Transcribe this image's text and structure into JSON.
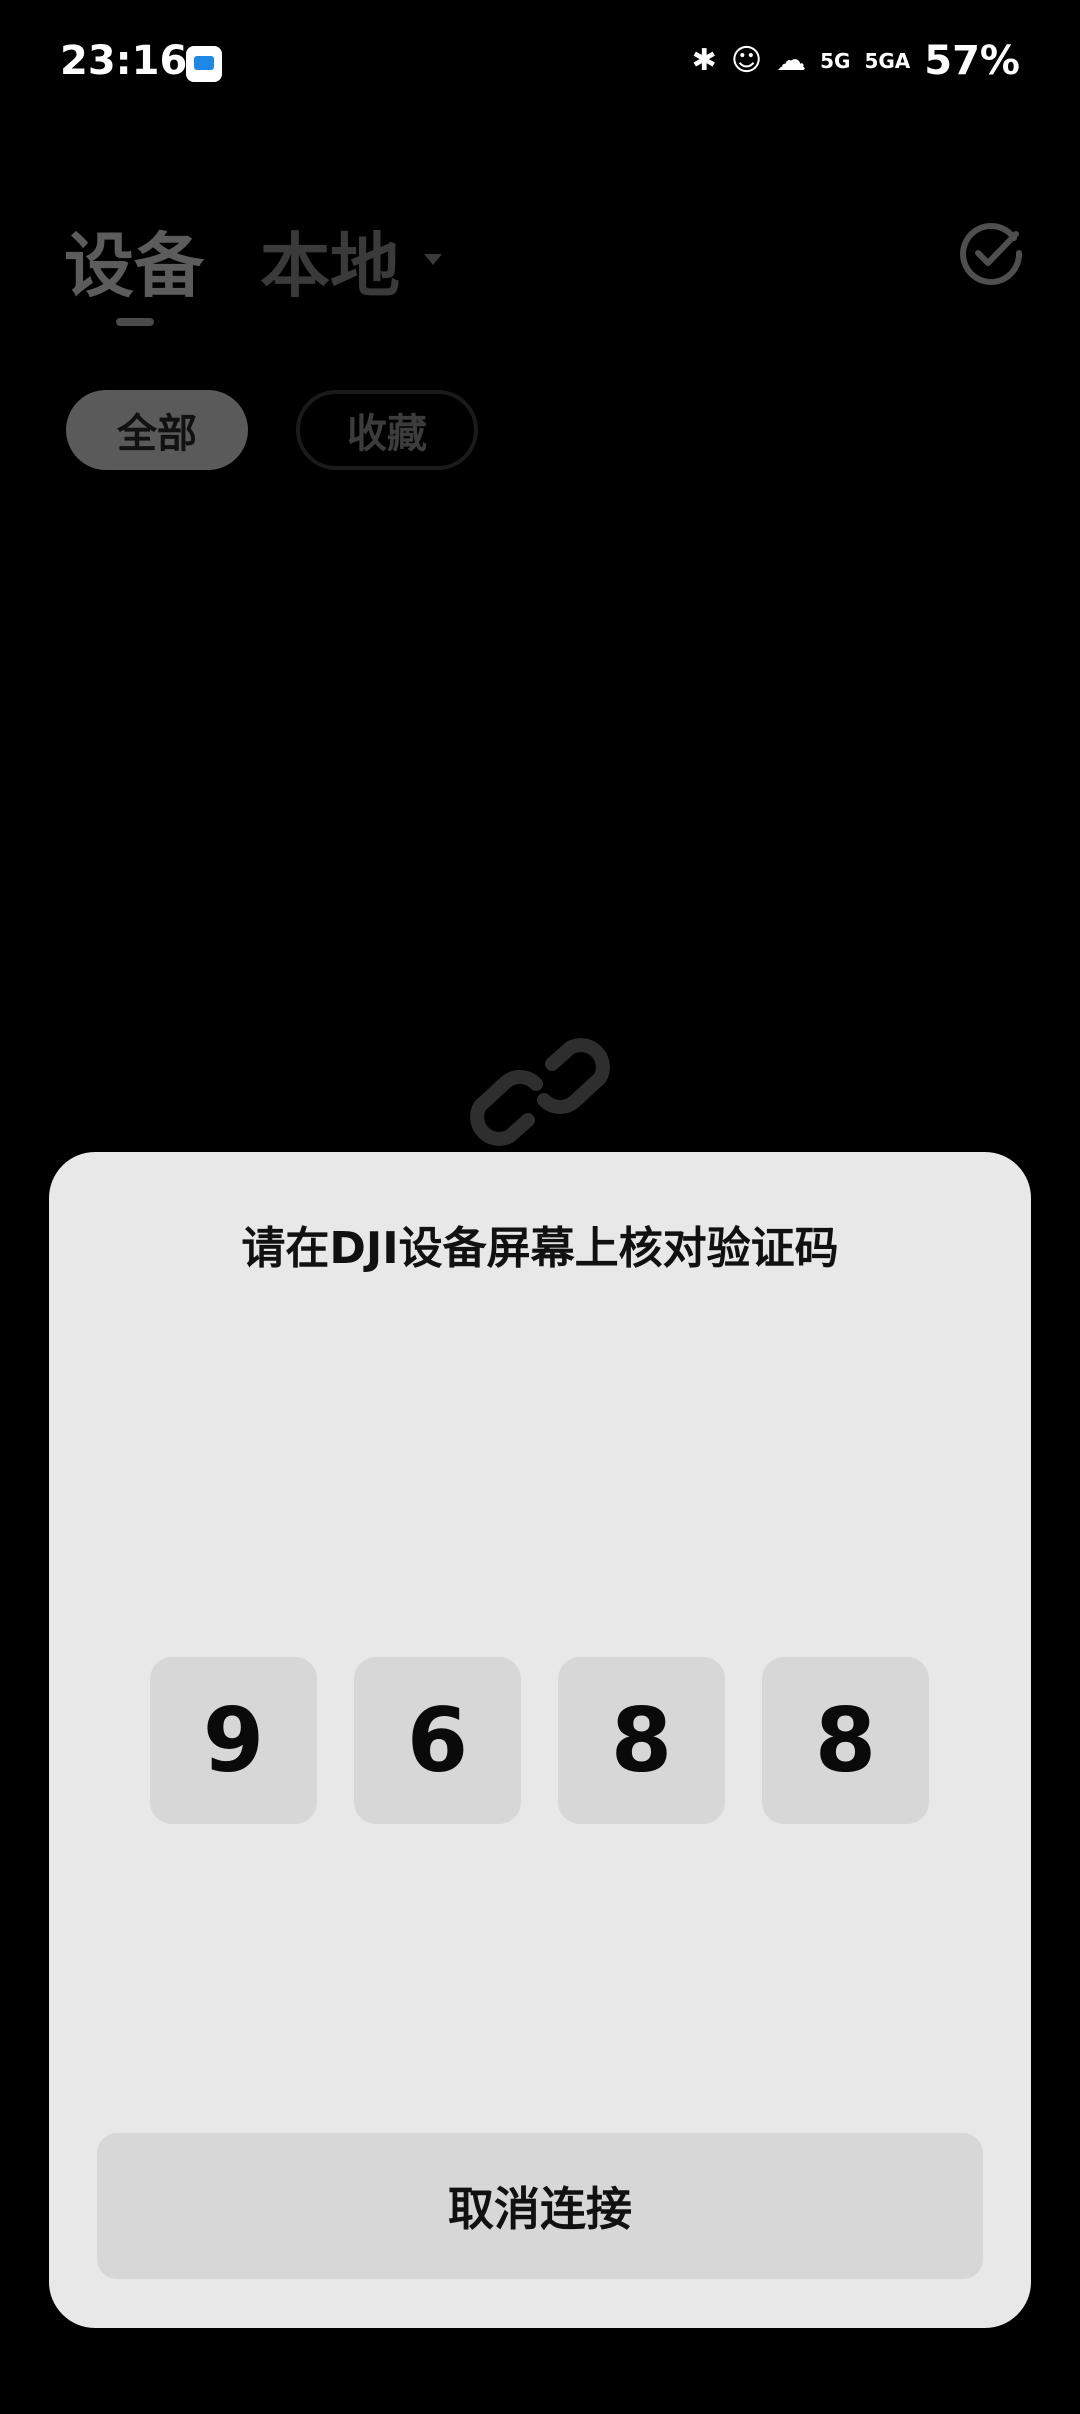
{
  "status_bar": {
    "time": "23:16",
    "icons": [
      "bluetooth-icon",
      "cat-icon",
      "dog-wifi-icon",
      "signal-5g-icon",
      "signal-5ga-icon"
    ],
    "icon_glyphs": [
      "✱",
      "☺",
      "☁",
      "5G",
      "5GA"
    ],
    "battery": "57%"
  },
  "header": {
    "tab_devices": "设备",
    "tab_local": "本地"
  },
  "filters": {
    "all": "全部",
    "favorites": "收藏"
  },
  "dialog": {
    "title": "请在DJI设备屏幕上核对验证码",
    "code": [
      "9",
      "6",
      "8",
      "8"
    ],
    "cancel_label": "取消连接"
  },
  "colors": {
    "background": "#000000",
    "dialog_bg": "#e8e8e8",
    "digit_box": "#d7d7d7",
    "muted_text": "#5c5c5c"
  }
}
